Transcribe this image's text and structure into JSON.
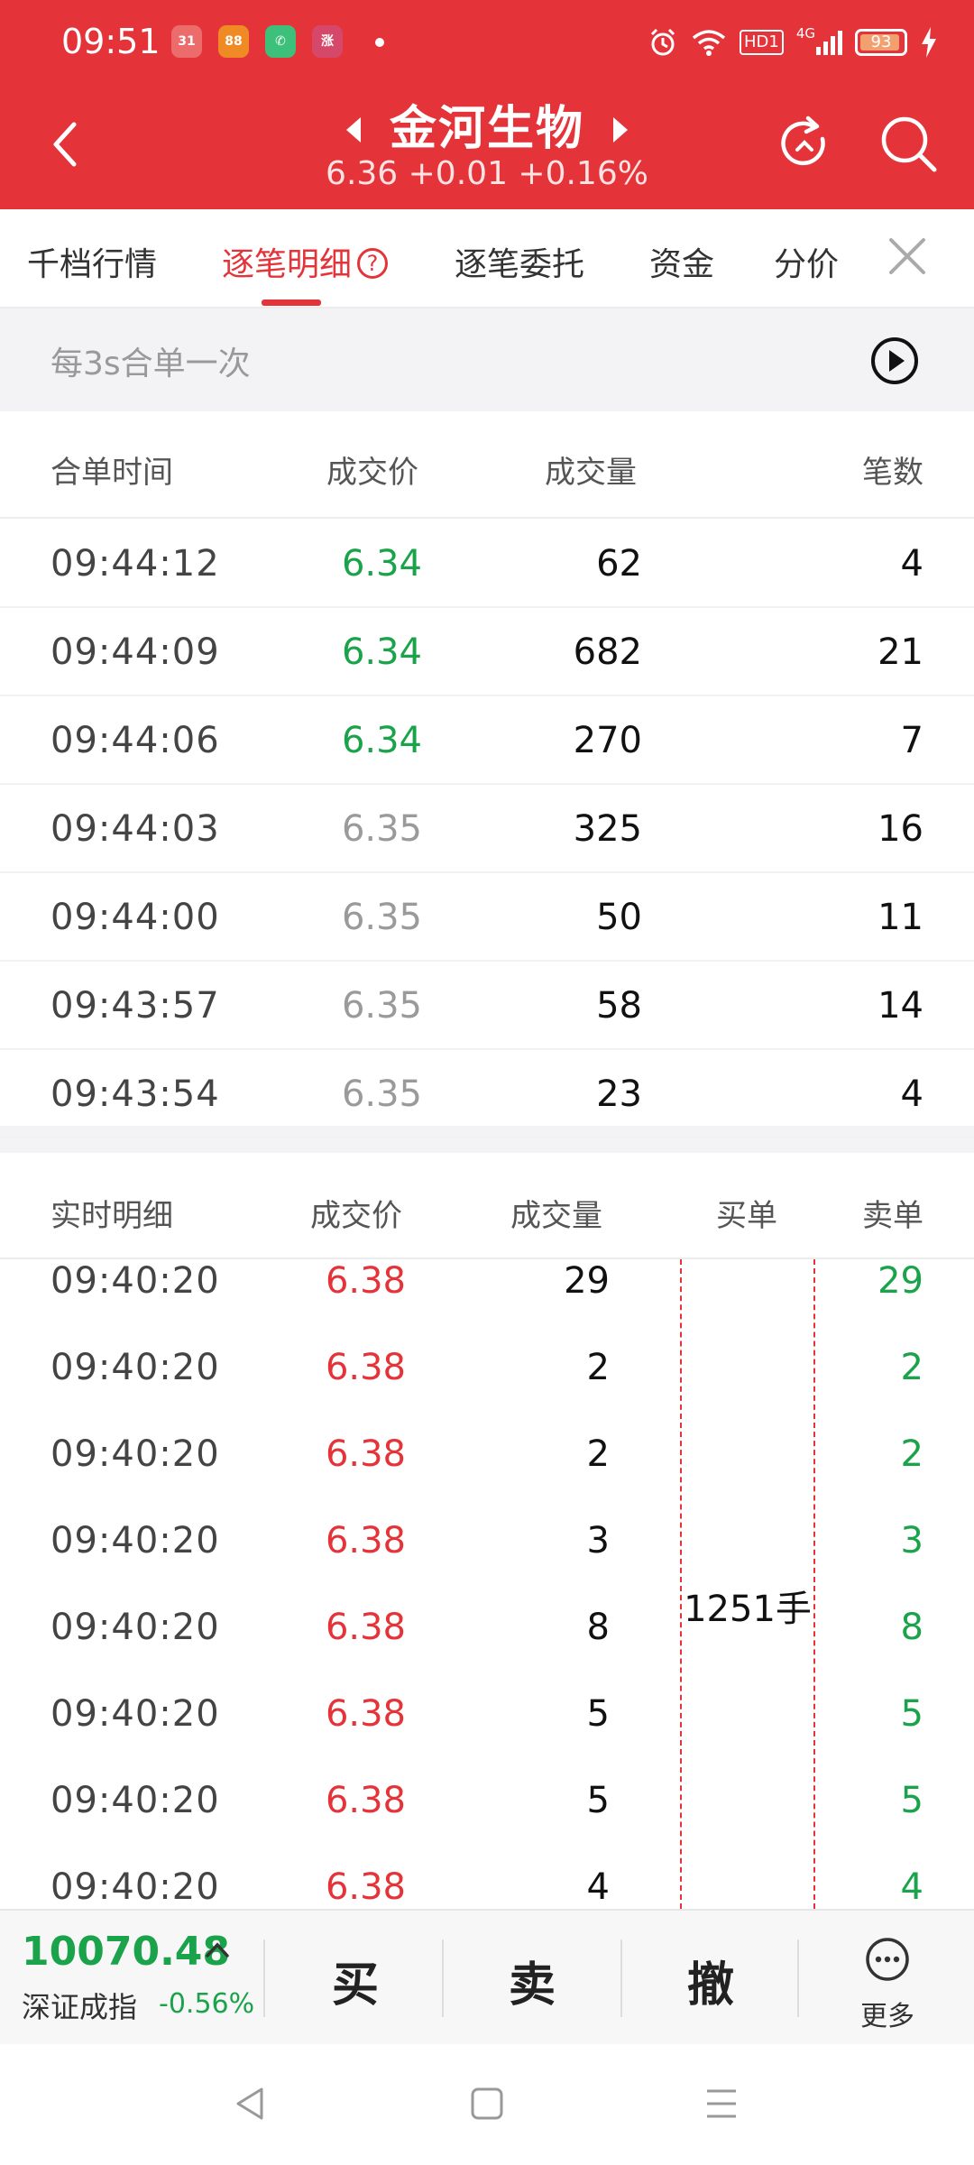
{
  "status_bar": {
    "time": "09:51",
    "battery_level": "93",
    "battery_fraction": 0.93,
    "network": "4G",
    "hd_badge": "HD1",
    "app_icons": [
      "calendar-icon",
      "app-icon",
      "phone-icon",
      "app-icon"
    ]
  },
  "header": {
    "stock_name": "金河生物",
    "quote": "6.36 +0.01 +0.16%"
  },
  "tabs": {
    "items": [
      "千档行情",
      "逐笔明细",
      "逐笔委托",
      "资金",
      "分价"
    ],
    "active": "逐笔明细"
  },
  "merge_bar": {
    "label": "每3s合单一次"
  },
  "merged_table": {
    "headers": [
      "合单时间",
      "成交价",
      "成交量",
      "笔数"
    ],
    "rows": [
      {
        "time": "09:44:12",
        "price": "6.34",
        "volume": "62",
        "count": "4",
        "color": "green"
      },
      {
        "time": "09:44:09",
        "price": "6.34",
        "volume": "682",
        "count": "21",
        "color": "green"
      },
      {
        "time": "09:44:06",
        "price": "6.34",
        "volume": "270",
        "count": "7",
        "color": "green"
      },
      {
        "time": "09:44:03",
        "price": "6.35",
        "volume": "325",
        "count": "16",
        "color": "gray"
      },
      {
        "time": "09:44:00",
        "price": "6.35",
        "volume": "50",
        "count": "11",
        "color": "gray"
      },
      {
        "time": "09:43:57",
        "price": "6.35",
        "volume": "58",
        "count": "14",
        "color": "gray"
      },
      {
        "time": "09:43:54",
        "price": "6.35",
        "volume": "23",
        "count": "4",
        "color": "gray"
      }
    ]
  },
  "realtime_table": {
    "headers": [
      "实时明细",
      "成交价",
      "成交量",
      "买单",
      "卖单"
    ],
    "buy_order_total": "1251手",
    "rows": [
      {
        "time": "09:40:20",
        "price": "6.38",
        "volume": "29",
        "sell": "29"
      },
      {
        "time": "09:40:20",
        "price": "6.38",
        "volume": "2",
        "sell": "2"
      },
      {
        "time": "09:40:20",
        "price": "6.38",
        "volume": "2",
        "sell": "2"
      },
      {
        "time": "09:40:20",
        "price": "6.38",
        "volume": "3",
        "sell": "3"
      },
      {
        "time": "09:40:20",
        "price": "6.38",
        "volume": "8",
        "sell": "8"
      },
      {
        "time": "09:40:20",
        "price": "6.38",
        "volume": "5",
        "sell": "5"
      },
      {
        "time": "09:40:20",
        "price": "6.38",
        "volume": "5",
        "sell": "5"
      },
      {
        "time": "09:40:20",
        "price": "6.38",
        "volume": "4",
        "sell": "4"
      }
    ]
  },
  "bottom_bar": {
    "index_value": "10070.48",
    "index_name": "深证成指",
    "index_change": "-0.56%",
    "buy_label": "买",
    "sell_label": "卖",
    "cancel_label": "撤",
    "more_label": "更多"
  },
  "colors": {
    "brand_red": "#e4343a",
    "up_red": "#e4343a",
    "down_green": "#1aa34a",
    "flat_gray": "#9a9a9a"
  }
}
